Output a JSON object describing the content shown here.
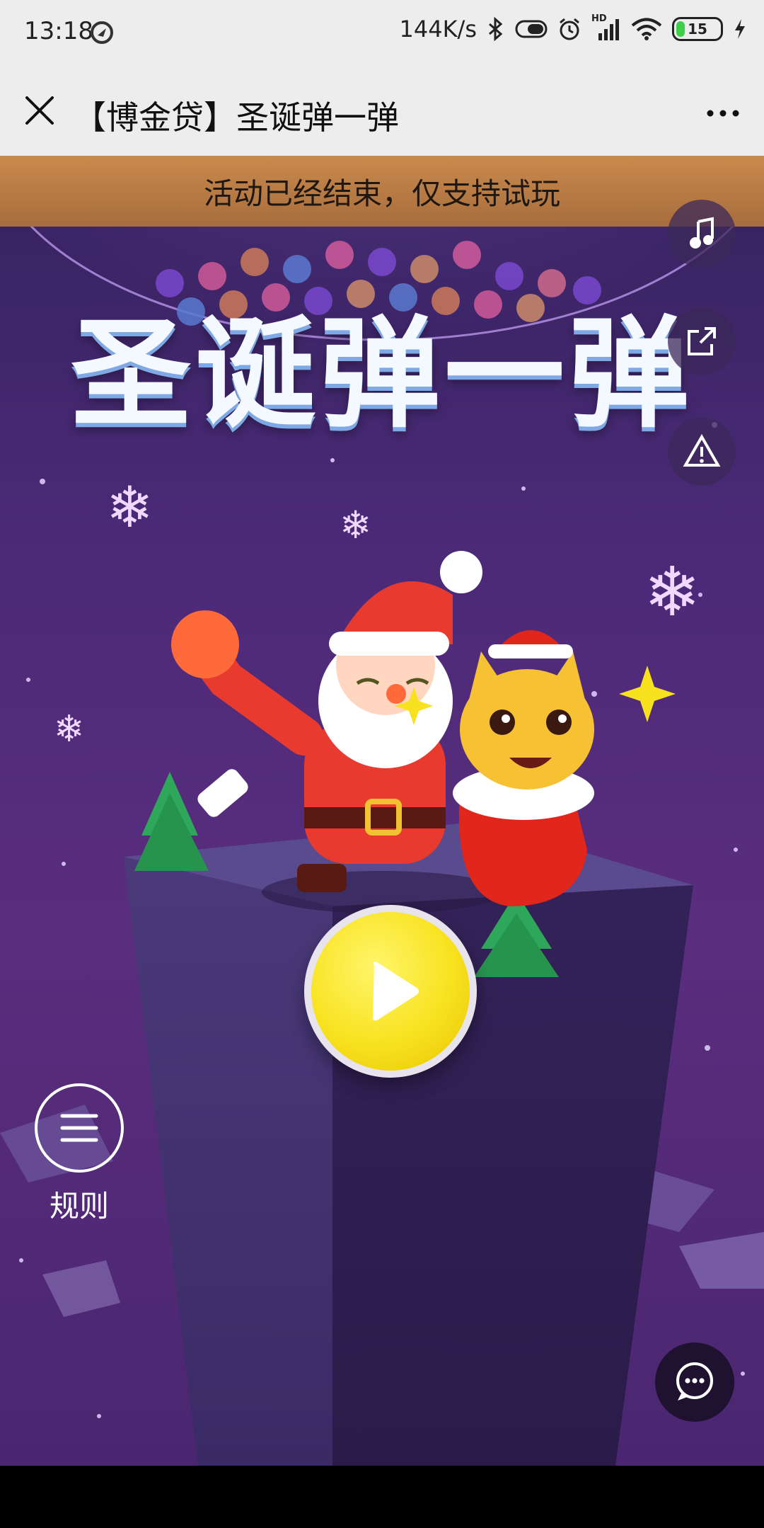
{
  "status_bar": {
    "time": "13:18",
    "net_speed": "144K/s",
    "battery": "15",
    "network_label": "HD"
  },
  "title_bar": {
    "title": "【博金贷】圣诞弹一弹",
    "close_icon": "close-icon",
    "more_icon": "more-icon"
  },
  "banner": {
    "text": "活动已经结束，仅支持试玩"
  },
  "hero": {
    "title": "圣诞弹一弹"
  },
  "rules": {
    "label": "规则"
  },
  "colors": {
    "accent": "#f8e21f",
    "banner": "#c98a4c",
    "bg": "#4b2a78"
  }
}
